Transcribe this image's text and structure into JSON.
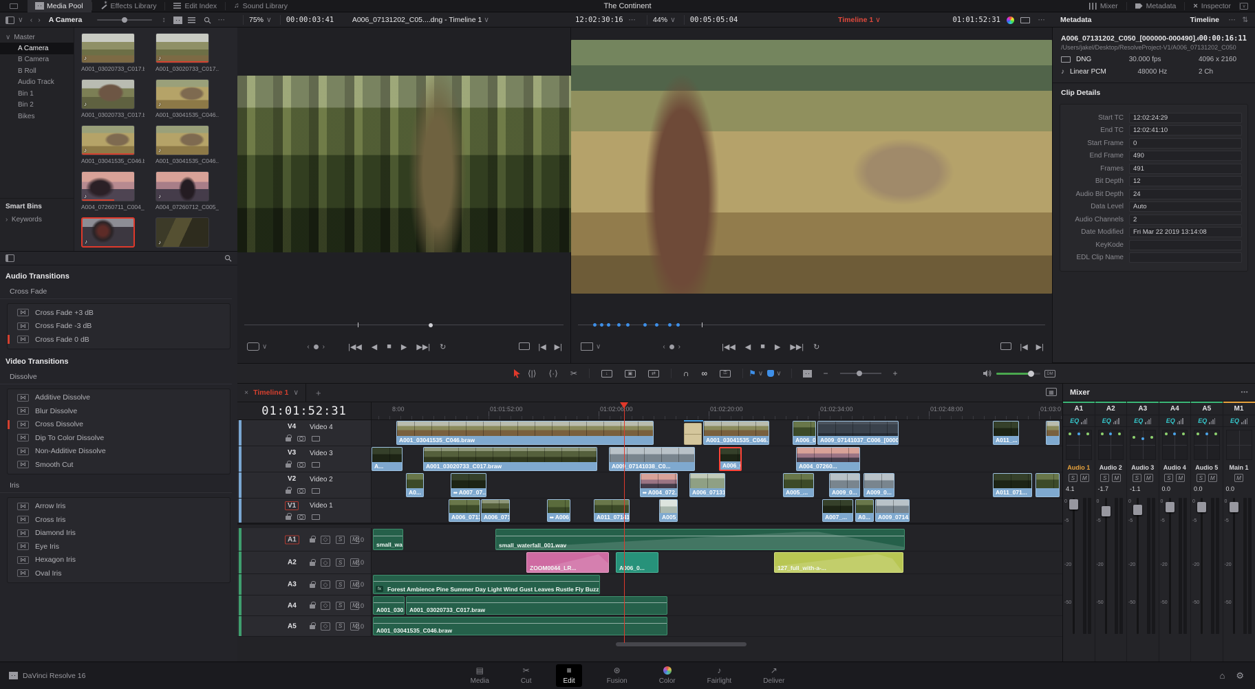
{
  "app": {
    "title": "The Continent",
    "brand": "DaVinci Resolve 16"
  },
  "menubar": {
    "left": [
      {
        "label": "Media Pool"
      },
      {
        "label": "Effects Library"
      },
      {
        "label": "Edit Index"
      },
      {
        "label": "Sound Library"
      }
    ],
    "right": [
      {
        "label": "Mixer"
      },
      {
        "label": "Metadata"
      },
      {
        "label": "Inspector"
      }
    ]
  },
  "media_pool": {
    "current_bin": "A Camera",
    "tree": {
      "root": "Master",
      "items": [
        {
          "label": "A Camera"
        },
        {
          "label": "B Camera"
        },
        {
          "label": "B Roll"
        },
        {
          "label": "Audio Track"
        },
        {
          "label": "Bin 1"
        },
        {
          "label": "Bin 2"
        },
        {
          "label": "Bikes"
        }
      ]
    },
    "smart_bins_label": "Smart Bins",
    "keywords_label": "Keywords",
    "clips": [
      {
        "name": "A001_03020733_C017.br..."
      },
      {
        "name": "A001_03020733_C017..."
      },
      {
        "name": "A001_03020733_C017.br..."
      },
      {
        "name": "A001_03041535_C046..."
      },
      {
        "name": "A001_03041535_C046.br..."
      },
      {
        "name": "A001_03041535_C046..."
      },
      {
        "name": "A004_07260711_C004_[..."
      },
      {
        "name": "A004_07260712_C005_..."
      },
      {
        "name": ""
      },
      {
        "name": ""
      }
    ]
  },
  "source_viewer": {
    "zoom": "75%",
    "duration": "00:00:03:41",
    "title": "A006_07131202_C05....dng - Timeline 1",
    "timecode": "12:02:30:16"
  },
  "timeline_viewer": {
    "zoom": "44%",
    "duration": "00:05:05:04",
    "label": "Timeline 1",
    "timecode": "01:01:52:31"
  },
  "metadata": {
    "panel_title": "Metadata",
    "scope": "Timeline",
    "clip_name": "A006_07131202_C050_[000000-000490].dng",
    "clip_duration": "00:00:16:11",
    "clip_path": "/Users/jakel/Desktop/ResolveProject-V1/A006_07131202_C050",
    "video_codec": "DNG",
    "fps": "30.000 fps",
    "resolution": "4096 x 2160",
    "audio_codec": "Linear PCM",
    "sample_rate": "48000 Hz",
    "channels": "2 Ch",
    "details_title": "Clip Details",
    "fields": [
      {
        "label": "Start TC",
        "value": "12:02:24:29"
      },
      {
        "label": "End TC",
        "value": "12:02:41:10"
      },
      {
        "label": "Start Frame",
        "value": "0"
      },
      {
        "label": "End Frame",
        "value": "490"
      },
      {
        "label": "Frames",
        "value": "491"
      },
      {
        "label": "Bit Depth",
        "value": "12"
      },
      {
        "label": "Audio Bit Depth",
        "value": "24"
      },
      {
        "label": "Data Level",
        "value": "Auto"
      },
      {
        "label": "Audio Channels",
        "value": "2"
      },
      {
        "label": "Date Modified",
        "value": "Fri Mar 22 2019 13:14:08"
      },
      {
        "label": "KeyKode",
        "value": ""
      },
      {
        "label": "EDL Clip Name",
        "value": ""
      }
    ]
  },
  "effects": {
    "audio_transitions_title": "Audio Transitions",
    "cross_fade_group": "Cross Fade",
    "cross_fade_items": [
      {
        "label": "Cross Fade +3 dB"
      },
      {
        "label": "Cross Fade -3 dB"
      },
      {
        "label": "Cross Fade 0 dB"
      }
    ],
    "video_transitions_title": "Video Transitions",
    "dissolve_group": "Dissolve",
    "dissolve_items": [
      {
        "label": "Additive Dissolve"
      },
      {
        "label": "Blur Dissolve"
      },
      {
        "label": "Cross Dissolve"
      },
      {
        "label": "Dip To Color Dissolve"
      },
      {
        "label": "Non-Additive Dissolve"
      },
      {
        "label": "Smooth Cut"
      }
    ],
    "iris_group": "Iris",
    "iris_items": [
      {
        "label": "Arrow Iris"
      },
      {
        "label": "Cross Iris"
      },
      {
        "label": "Diamond Iris"
      },
      {
        "label": "Eye Iris"
      },
      {
        "label": "Hexagon Iris"
      },
      {
        "label": "Oval Iris"
      }
    ]
  },
  "timeline": {
    "tab": "Timeline 1",
    "timecode": "01:01:52:31",
    "ruler": [
      "8:00",
      "01:01:52:00",
      "01:02:06:00",
      "01:02:20:00",
      "01:02:34:00",
      "01:02:48:00",
      "01:03:0"
    ],
    "video_tracks": [
      {
        "id": "V4",
        "label": "Video 4",
        "clips": [
          {
            "name": "A001_03041535_C046.braw"
          },
          {
            "name": ""
          },
          {
            "name": "A001_03041535_C046...."
          },
          {
            "name": "A006_0..."
          },
          {
            "name": "A009_07141037_C006_[0000..."
          },
          {
            "name": "A011_..."
          }
        ]
      },
      {
        "id": "V3",
        "label": "Video 3",
        "clips": [
          {
            "name": "A..."
          },
          {
            "name": "A001_03020733_C017.braw"
          },
          {
            "name": "A009_07141038_C0..."
          },
          {
            "name": "A006_0..."
          },
          {
            "name": "A004_07260..."
          }
        ]
      },
      {
        "id": "V2",
        "label": "Video 2",
        "clips": [
          {
            "name": "A0..."
          },
          {
            "name": "A007_07..."
          },
          {
            "name": "A004_072..."
          },
          {
            "name": "A006_071310..."
          },
          {
            "name": "A005_..."
          },
          {
            "name": "A009_0..."
          },
          {
            "name": "A009_0..."
          },
          {
            "name": "A011_071..."
          }
        ]
      },
      {
        "id": "V1",
        "label": "Video 1",
        "clips": [
          {
            "name": "A006_07131137..."
          },
          {
            "name": "A006_0713114..."
          },
          {
            "name": "A006_..."
          },
          {
            "name": "A011_07141228_C0..."
          },
          {
            "name": "A005_..."
          },
          {
            "name": "A007_..."
          },
          {
            "name": "A0..."
          },
          {
            "name": "A009_0714..."
          }
        ]
      }
    ],
    "audio_tracks": [
      {
        "id": "A1",
        "format": "2.0",
        "clips": [
          {
            "name": "small_wa..."
          },
          {
            "name": "small_waterfall_001.wav"
          }
        ]
      },
      {
        "id": "A2",
        "format": "2.0",
        "clips": [
          {
            "name": "ZOOM0044_LR..."
          },
          {
            "name": "A006_0..."
          },
          {
            "name": "127_full_with-a-..."
          }
        ]
      },
      {
        "id": "A3",
        "format": "2.0",
        "clips": [
          {
            "name": "Forest Ambience Pine Summer Day Light Wind Gust Leaves Rustle Fly Buzz Distant Bird Crow Ca..."
          }
        ]
      },
      {
        "id": "A4",
        "format": "2.0",
        "clips": [
          {
            "name": "A001_030..."
          },
          {
            "name": "A001_03020733_C017.braw"
          }
        ]
      },
      {
        "id": "A5",
        "format": "2.0",
        "clips": [
          {
            "name": "A001_03041535_C046.braw"
          }
        ]
      }
    ]
  },
  "mixer": {
    "title": "Mixer",
    "solo": "S",
    "mute": "M",
    "eq_label": "EQ",
    "scale": [
      "0",
      "-5",
      "-20",
      "-50"
    ],
    "strips": [
      {
        "id": "A1",
        "name": "Audio 1",
        "value": "4.1"
      },
      {
        "id": "A2",
        "name": "Audio 2",
        "value": "-1.7"
      },
      {
        "id": "A3",
        "name": "Audio 3",
        "value": "-1.1"
      },
      {
        "id": "A4",
        "name": "Audio 4",
        "value": "0.0"
      },
      {
        "id": "A5",
        "name": "Audio 5",
        "value": "0.0"
      },
      {
        "id": "M1",
        "name": "Main 1",
        "value": "0.0"
      }
    ]
  },
  "nav": {
    "pages": [
      {
        "label": "Media"
      },
      {
        "label": "Cut"
      },
      {
        "label": "Edit"
      },
      {
        "label": "Fusion"
      },
      {
        "label": "Color"
      },
      {
        "label": "Fairlight"
      },
      {
        "label": "Deliver"
      }
    ]
  }
}
